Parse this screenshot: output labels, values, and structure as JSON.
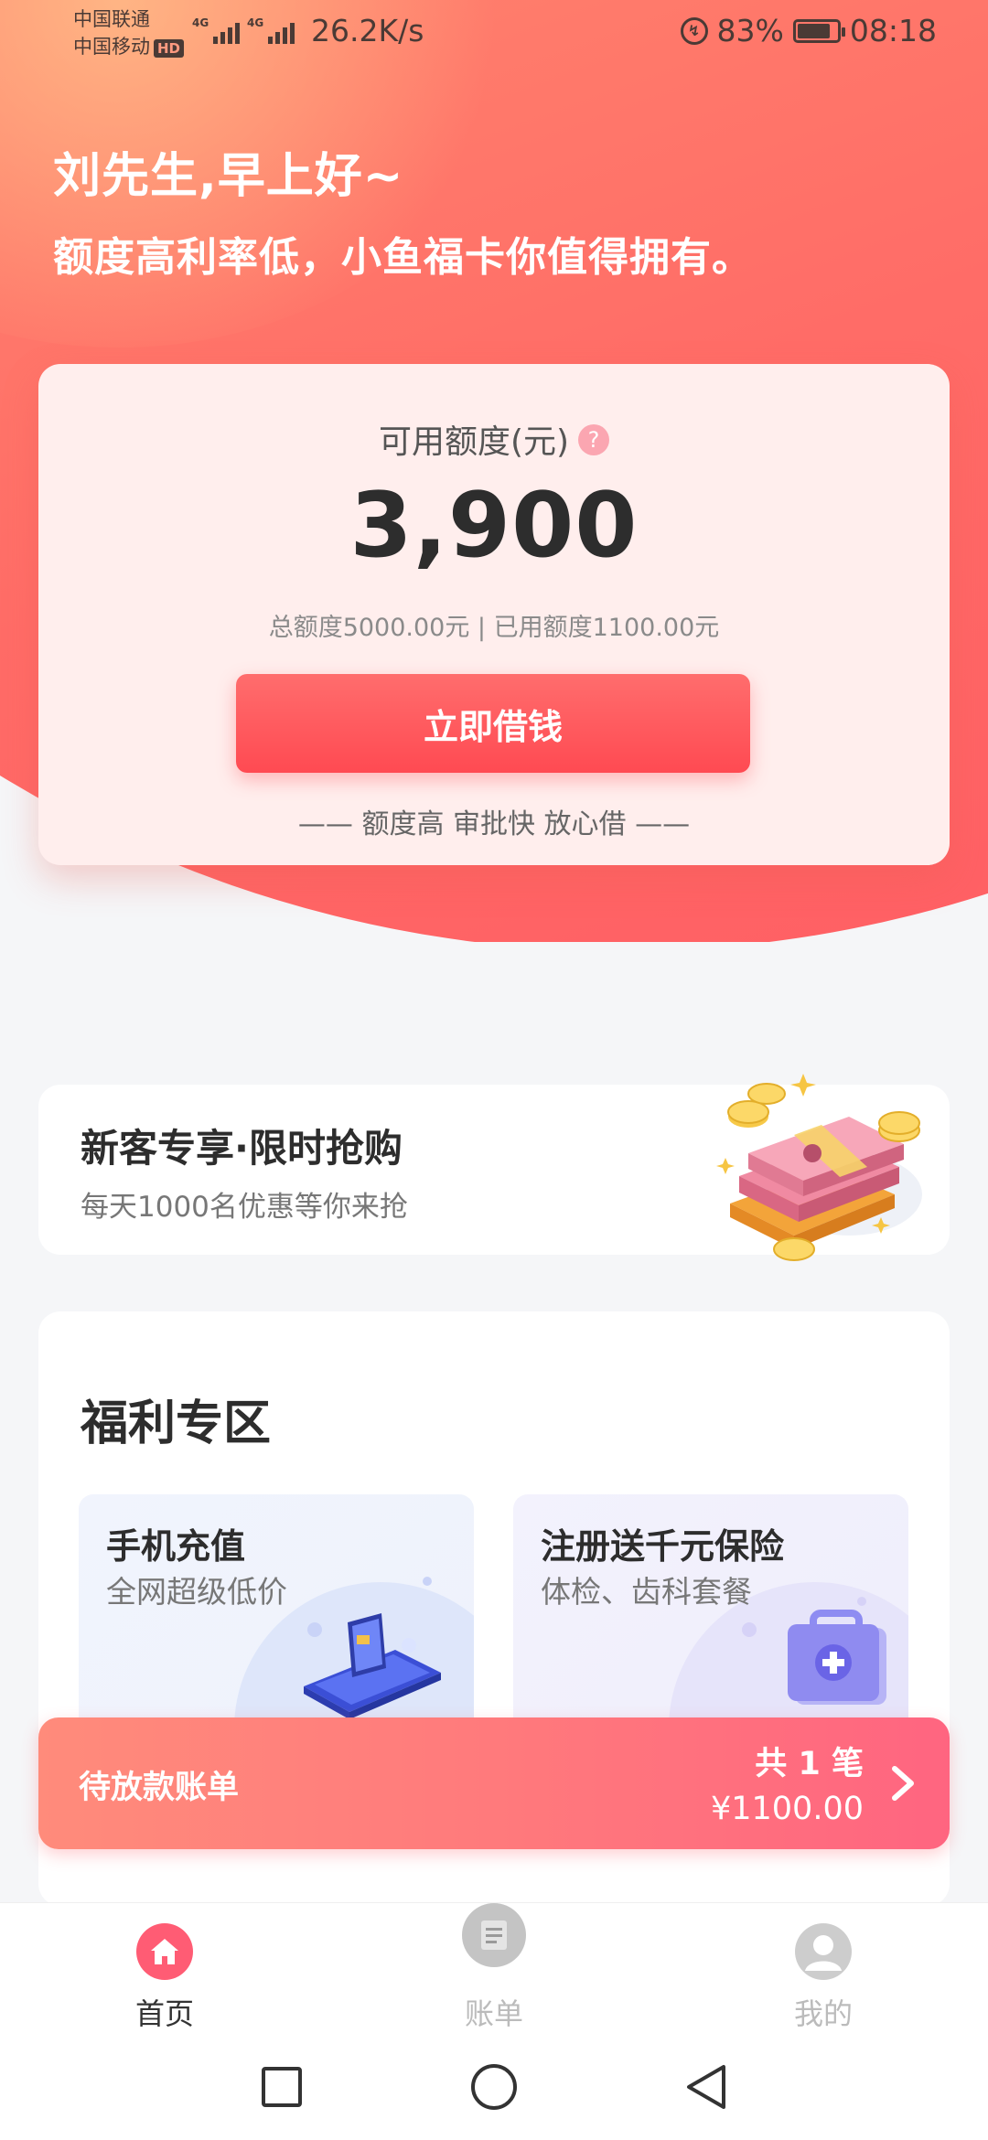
{
  "status_bar": {
    "carrier_1": "中国联通",
    "carrier_2": "中国移动",
    "hd_badge": "HD",
    "network_type": "4G",
    "net_speed": "26.2K/s",
    "battery_percent": "83%",
    "battery_level": 0.83,
    "time": "08:18"
  },
  "hero": {
    "greeting": "刘先生,早上好~",
    "slogan": "额度高利率低，小鱼福卡你值得拥有。"
  },
  "credit_card": {
    "label": "可用额度(元)",
    "help_icon_text": "?",
    "available_amount": "3,900",
    "detail": "总额度5000.00元 | 已用额度1100.00元",
    "borrow_button": "立即借钱",
    "tagline": "—— 额度高 审批快 放心借 ——"
  },
  "promo": {
    "title": "新客专享·限时抢购",
    "subtitle": "每天1000名优惠等你来抢",
    "illustration_icon": "money-stack-icon"
  },
  "welfare": {
    "title": "福利专区",
    "items": [
      {
        "title": "手机充值",
        "subtitle": "全网超级低价",
        "icon": "phone-card-icon"
      },
      {
        "title": "注册送千元保险",
        "subtitle": "体检、齿科套餐",
        "icon": "medical-kit-icon"
      }
    ]
  },
  "pending_bill": {
    "title": "待放款账单",
    "count": "共 1 笔",
    "amount": "¥1100.00"
  },
  "bottom_nav": {
    "items": [
      {
        "label": "首页",
        "icon": "home-icon",
        "active": true
      },
      {
        "label": "账单",
        "icon": "bill-icon",
        "active": false
      },
      {
        "label": "我的",
        "icon": "profile-icon",
        "active": false
      }
    ]
  },
  "colors": {
    "accent": "#ff4a52",
    "hero_gradient_start": "#ffb27f",
    "hero_gradient_end": "#ff5a63",
    "nav_active": "#ff5c74",
    "banner_start": "#ff8b7b",
    "banner_end": "#ff6580"
  }
}
